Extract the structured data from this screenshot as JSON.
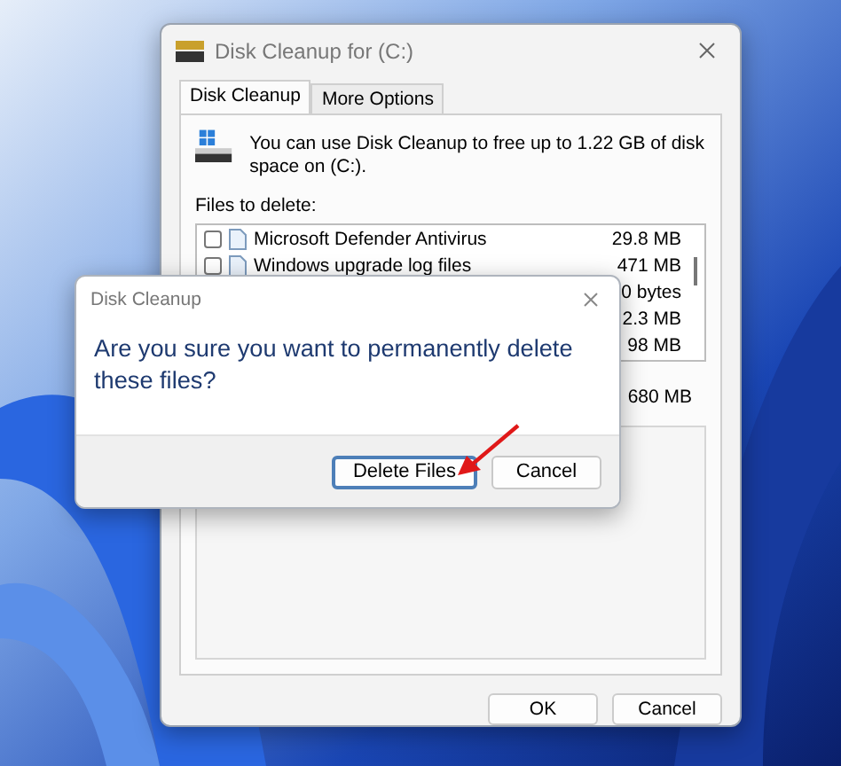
{
  "window": {
    "title": "Disk Cleanup for  (C:)"
  },
  "tabs": [
    {
      "label": "Disk Cleanup",
      "selected": true
    },
    {
      "label": "More Options",
      "selected": false
    }
  ],
  "intro": "You can use Disk Cleanup to free up to 1.22 GB of disk space on  (C:).",
  "files_label": "Files to delete:",
  "files": [
    {
      "name": "Microsoft Defender Antivirus",
      "size": "29.8 MB",
      "checked": false
    },
    {
      "name": "Windows upgrade log files",
      "size": "471 MB",
      "checked": false
    },
    {
      "size": "0 bytes"
    },
    {
      "size": "2.3 MB"
    },
    {
      "size": "98 MB"
    }
  ],
  "total": "680 MB",
  "buttons": [
    {
      "label": "OK"
    },
    {
      "label": "Cancel"
    }
  ],
  "dialog": {
    "title": "Disk Cleanup",
    "message": "Are you sure you want to permanently delete these files?",
    "buttons": [
      {
        "label": "Delete Files",
        "selected": true
      },
      {
        "label": "Cancel",
        "selected": false
      }
    ]
  }
}
